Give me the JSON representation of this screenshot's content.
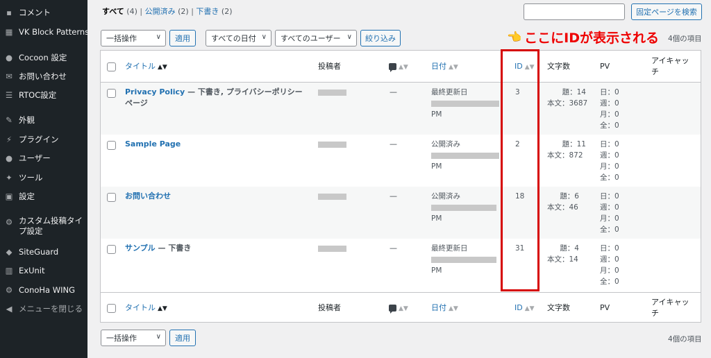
{
  "sidebar": {
    "items": [
      {
        "label": "コメント",
        "icon": "comment-icon"
      },
      {
        "label": "VK Block Patterns",
        "icon": "grid-icon"
      },
      {
        "label": "Cocoon 設定",
        "icon": "circle-icon"
      },
      {
        "label": "お問い合わせ",
        "icon": "mail-icon"
      },
      {
        "label": "RTOC設定",
        "icon": "list-icon"
      },
      {
        "label": "外観",
        "icon": "brush-icon"
      },
      {
        "label": "プラグイン",
        "icon": "plugin-icon"
      },
      {
        "label": "ユーザー",
        "icon": "user-icon"
      },
      {
        "label": "ツール",
        "icon": "wrench-icon"
      },
      {
        "label": "設定",
        "icon": "settings-icon"
      },
      {
        "label": "カスタム投稿タイプ設定",
        "icon": "gear-icon"
      },
      {
        "label": "SiteGuard",
        "icon": "shield-icon"
      },
      {
        "label": "ExUnit",
        "icon": "chart-icon"
      },
      {
        "label": "ConoHa WING",
        "icon": "gear-icon"
      },
      {
        "label": "メニューを閉じる",
        "icon": "collapse-icon"
      }
    ]
  },
  "filters": {
    "all": "すべて",
    "all_count": "(4)",
    "published": "公開済み",
    "published_count": "(2)",
    "draft": "下書き",
    "draft_count": "(2)",
    "sep": "|"
  },
  "search": {
    "button": "固定ページを検索",
    "value": ""
  },
  "bulk": {
    "action": "一括操作",
    "apply": "適用"
  },
  "date_filter": "すべての日付",
  "user_filter": "すべてのユーザー",
  "filter_button": "絞り込み",
  "items_count": "4個の項目",
  "annotation": {
    "text": "ここにIDが表示される",
    "hand": "👈"
  },
  "columns": {
    "title": "タイトル",
    "author": "投稿者",
    "date": "日付",
    "id": "ID",
    "chars": "文字数",
    "pv": "PV",
    "eyecatch": "アイキャッチ"
  },
  "rows": [
    {
      "title": "Privacy Policy",
      "state": " — 下書き, プライバシーポリシーページ",
      "comments": "—",
      "date_status": "最終更新日",
      "date_suffix": "PM",
      "id": "3",
      "chars_title": "題：14",
      "chars_body": "本文：3687",
      "pv_day": "日：0",
      "pv_week": "週：0",
      "pv_month": "月：0",
      "pv_all": "全：0"
    },
    {
      "title": "Sample Page",
      "state": "",
      "comments": "—",
      "date_status": "公開済み",
      "date_suffix": "PM",
      "id": "2",
      "chars_title": "題：11",
      "chars_body": "本文：872",
      "pv_day": "日：0",
      "pv_week": "週：0",
      "pv_month": "月：0",
      "pv_all": "全：0"
    },
    {
      "title": "お問い合わせ",
      "state": "",
      "comments": "—",
      "date_status": "公開済み",
      "date_suffix": "PM",
      "id": "18",
      "chars_title": "題：6",
      "chars_body": "本文：46",
      "pv_day": "日：0",
      "pv_week": "週：0",
      "pv_month": "月：0",
      "pv_all": "全：0"
    },
    {
      "title": "サンプル",
      "state": " — 下書き",
      "comments": "—",
      "date_status": "最終更新日",
      "date_suffix": "PM",
      "id": "31",
      "chars_title": "題：4",
      "chars_body": "本文：14",
      "pv_day": "日：0",
      "pv_week": "週：0",
      "pv_month": "月：0",
      "pv_all": "全：0"
    }
  ],
  "colors": {
    "accent": "#2271b1",
    "annotation": "#e00000",
    "sidebar": "#1d2327"
  }
}
